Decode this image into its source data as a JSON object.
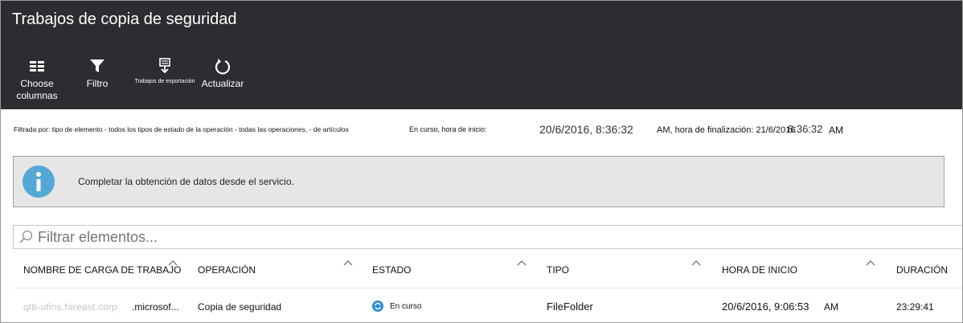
{
  "header": {
    "title": "Trabajos de copia de seguridad"
  },
  "toolbar": {
    "choose_columns": "Choose columnas",
    "filter": "Filtro",
    "export_jobs": "Trabajos de exportación",
    "refresh": "Actualizar"
  },
  "filter_summary": {
    "part1": "Filtrada por: tipo de elemento - todos los tipos de estado de la operación - todas las operaciones, - de artículos",
    "part2": "En curso, hora de inicio:",
    "start_value": "20/6/2016, 8:36:32",
    "start_suffix": "AM, hora de finalización: 21/6/2016",
    "end_time": "8:36:32",
    "end_suffix": "AM"
  },
  "info_banner": {
    "icon": "info-icon",
    "message": "Completar la obtención de datos desde el servicio."
  },
  "search": {
    "placeholder": "Filtrar elementos..."
  },
  "table": {
    "columns": [
      "NOMBRE DE CARGA DE TRABAJO",
      "OPERACIÓN",
      "ESTADO",
      "TIPO",
      "HORA DE INICIO",
      "DURACIÓN"
    ],
    "rows": [
      {
        "name_prefix": "qtb-ufins.fareast.corp",
        "name": ".microsof...",
        "operation": "Copia de seguridad",
        "status": "En curso",
        "status_icon": "sync-icon",
        "type": "FileFolder",
        "start_time": "20/6/2016, 9:06:53",
        "start_suffix": "AM",
        "duration": "23:29:41"
      }
    ]
  },
  "colors": {
    "header_bg": "#2b2d31",
    "info_icon": "#54a8d6",
    "info_bg": "#e6e6e6",
    "status_icon": "#2a8ad0"
  }
}
